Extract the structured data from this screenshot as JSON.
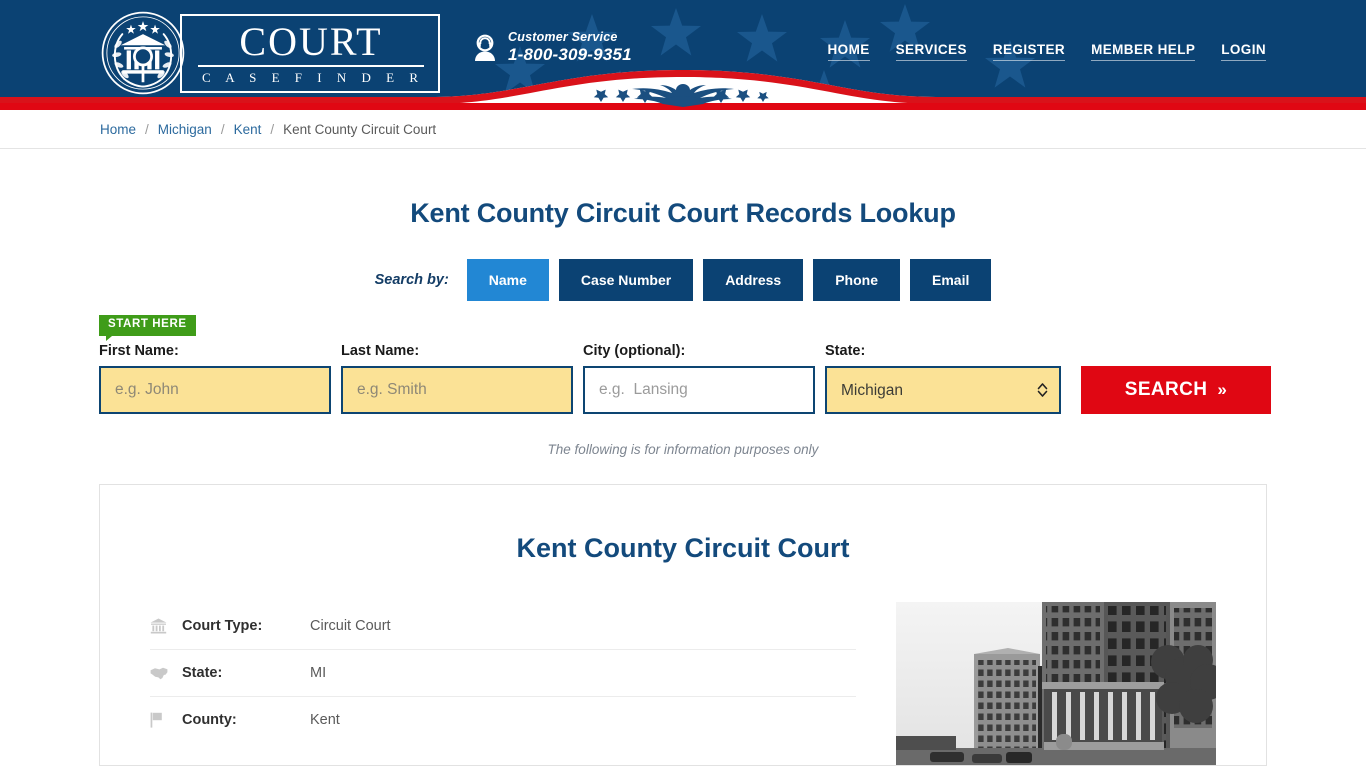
{
  "header": {
    "logo": {
      "word": "COURT",
      "sub": "C A S E   F I N D E R",
      "seal_icon": "court-seal-icon"
    },
    "customer_service": {
      "label": "Customer Service",
      "phone": "1-800-309-9351",
      "icon": "headset-agent-icon"
    },
    "nav": [
      {
        "label": "HOME"
      },
      {
        "label": "SERVICES"
      },
      {
        "label": "REGISTER"
      },
      {
        "label": "MEMBER HELP"
      },
      {
        "label": "LOGIN"
      }
    ],
    "colors": {
      "navy": "#0b4273",
      "red": "#e00713",
      "white": "#ffffff"
    }
  },
  "breadcrumb": {
    "items": [
      {
        "label": "Home",
        "link": true
      },
      {
        "label": "Michigan",
        "link": true
      },
      {
        "label": "Kent",
        "link": true
      },
      {
        "label": "Kent County Circuit Court",
        "link": false
      }
    ],
    "separator": "/"
  },
  "page": {
    "title": "Kent County Circuit Court Records Lookup",
    "disclaimer": "The following is for information purposes only"
  },
  "search": {
    "search_by_label": "Search by:",
    "tabs": [
      {
        "label": "Name",
        "active": true
      },
      {
        "label": "Case Number",
        "active": false
      },
      {
        "label": "Address",
        "active": false
      },
      {
        "label": "Phone",
        "active": false
      },
      {
        "label": "Email",
        "active": false
      }
    ],
    "start_here_badge": "START HERE",
    "fields": {
      "first_name": {
        "label": "First Name:",
        "placeholder": "e.g. John",
        "value": ""
      },
      "last_name": {
        "label": "Last Name:",
        "placeholder": "e.g. Smith",
        "value": ""
      },
      "city": {
        "label": "City (optional):",
        "placeholder": "e.g.  Lansing",
        "value": ""
      },
      "state": {
        "label": "State:",
        "selected": "Michigan",
        "options": [
          "Michigan"
        ]
      }
    },
    "submit_label": "SEARCH",
    "submit_chevron": "»",
    "accent_color": "#e00713",
    "active_tab_color": "#2287d4",
    "field_fill_color": "#fbe296"
  },
  "court_card": {
    "title": "Kent County Circuit Court",
    "details": [
      {
        "icon": "bank-icon",
        "key": "Court Type:",
        "value": "Circuit Court"
      },
      {
        "icon": "us-map-icon",
        "key": "State:",
        "value": "MI"
      },
      {
        "icon": "flag-icon",
        "key": "County:",
        "value": "Kent"
      }
    ],
    "photo_alt": "courthouse-photo"
  }
}
